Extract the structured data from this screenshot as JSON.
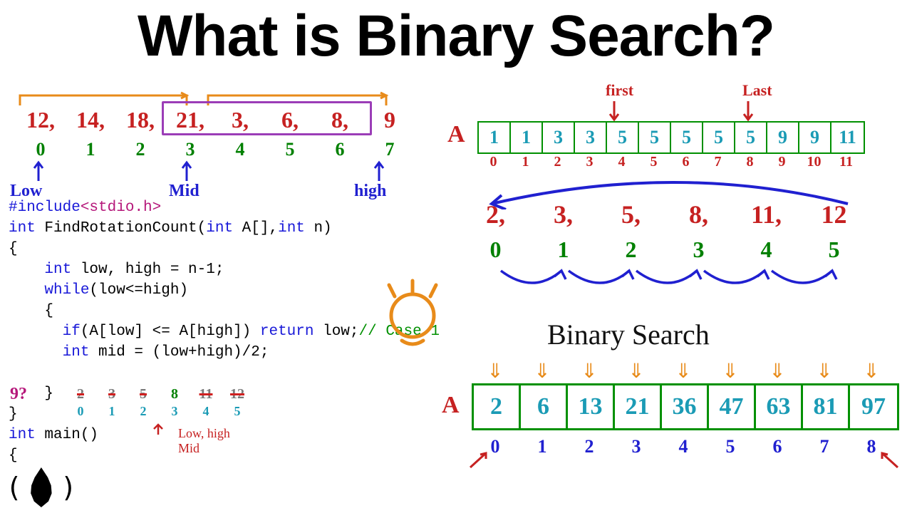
{
  "title": "What is Binary Search?",
  "rotated_array": {
    "values": [
      "12,",
      "14,",
      "18,",
      "21,",
      "3,",
      "6,",
      "8,",
      "9"
    ],
    "indices": [
      "0",
      "1",
      "2",
      "3",
      "4",
      "5",
      "6",
      "7"
    ],
    "labels": {
      "low": "Low",
      "mid": "Mid",
      "high": "high"
    }
  },
  "code": {
    "l1a": "#include",
    "l1b": "<stdio.h>",
    "l2a": "int",
    "l2b": " FindRotationCount(",
    "l2c": "int",
    "l2d": " A[],",
    "l2e": "int",
    "l2f": " n)",
    "l3": "{",
    "l4a": "    int",
    "l4b": " low, high = n-1;",
    "l5a": "    while",
    "l5b": "(low<=high)",
    "l6": "    {",
    "l7a": "      if",
    "l7b": "(A[low] <= A[high]) ",
    "l7c": "return",
    "l7d": " low;",
    "l7e": "// Case 1",
    "l8a": "      int",
    "l8b": " mid = (low+high)/2;",
    "l9": "    }",
    "l10": "}",
    "l11a": "int",
    "l11b": " main()",
    "l12": "{"
  },
  "nine_q": "9?",
  "tiny_array": {
    "vals": [
      "2",
      "3",
      "5",
      "8",
      "11",
      "12"
    ],
    "crossed": [
      true,
      true,
      true,
      false,
      true,
      true
    ],
    "idx": [
      "0",
      "1",
      "2",
      "3",
      "4",
      "5"
    ],
    "ptr_label": "Low, high\nMid"
  },
  "array_A": {
    "label": "A",
    "first": "first",
    "last": "Last",
    "cells": [
      "1",
      "1",
      "3",
      "3",
      "5",
      "5",
      "5",
      "5",
      "5",
      "9",
      "9",
      "11"
    ],
    "idx": [
      "0",
      "1",
      "2",
      "3",
      "4",
      "5",
      "6",
      "7",
      "8",
      "9",
      "10",
      "11"
    ]
  },
  "sorted_6": {
    "vals": [
      "2,",
      "3,",
      "5,",
      "8,",
      "11,",
      "12"
    ],
    "idx": [
      "0",
      "1",
      "2",
      "3",
      "4",
      "5"
    ]
  },
  "bs_label": "Binary  Search",
  "array_B": {
    "label": "A",
    "cells": [
      "2",
      "6",
      "13",
      "21",
      "36",
      "47",
      "63",
      "81",
      "97"
    ],
    "idx": [
      "0",
      "1",
      "2",
      "3",
      "4",
      "5",
      "6",
      "7",
      "8"
    ]
  }
}
